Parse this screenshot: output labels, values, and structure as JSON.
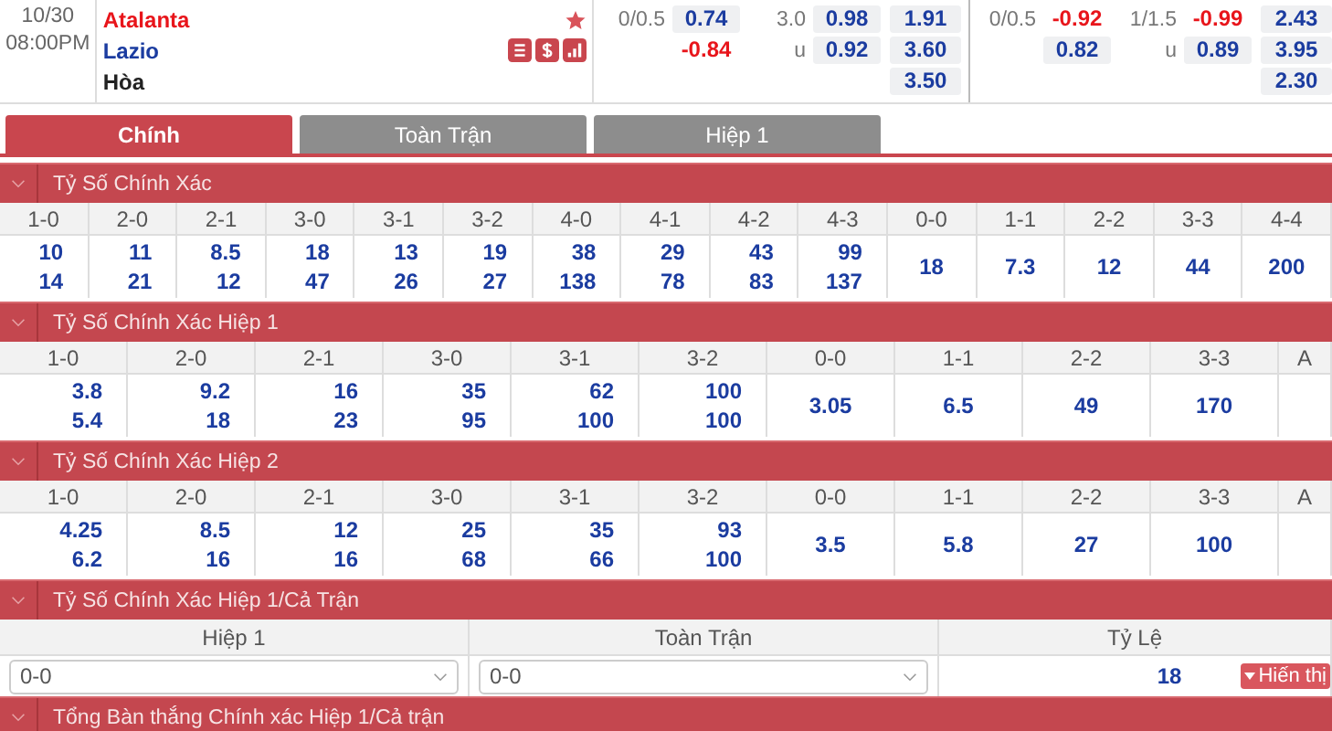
{
  "match": {
    "date": "10/30",
    "time": "08:00PM",
    "favorite": true,
    "teams": [
      {
        "name": "Atalanta",
        "kind": "home"
      },
      {
        "name": "Lazio",
        "kind": "away"
      },
      {
        "name": "Hòa",
        "kind": "draw"
      }
    ],
    "odds_groups": [
      {
        "handicap": [
          {
            "line": "0/0.5",
            "odds": "0.74",
            "kind": "normal"
          },
          {
            "odds": "-0.84",
            "kind": "negative"
          }
        ],
        "over_under": [
          {
            "line": "3.0",
            "odds": "0.98",
            "kind": "normal"
          },
          {
            "line": "u",
            "odds": "0.92",
            "kind": "normal"
          }
        ],
        "one_x_two": [
          "1.91",
          "3.60",
          "3.50"
        ]
      },
      {
        "handicap": [
          {
            "line": "0/0.5",
            "odds": "-0.92",
            "kind": "negative"
          },
          {
            "odds": "0.82",
            "kind": "normal"
          }
        ],
        "over_under": [
          {
            "line": "1/1.5",
            "odds": "-0.99",
            "kind": "negative"
          },
          {
            "line": "u",
            "odds": "0.89",
            "kind": "normal"
          }
        ],
        "one_x_two": [
          "2.43",
          "3.95",
          "2.30"
        ]
      }
    ]
  },
  "tabs": [
    {
      "label": "Chính",
      "selected": true
    },
    {
      "label": "Toàn Trận",
      "selected": false
    },
    {
      "label": "Hiệp 1",
      "selected": false
    }
  ],
  "sections": [
    {
      "title": "Tỷ Số Chính Xác",
      "kind": "grid",
      "columns": [
        {
          "label": "1-0",
          "values": [
            "10",
            "14"
          ]
        },
        {
          "label": "2-0",
          "values": [
            "11",
            "21"
          ]
        },
        {
          "label": "2-1",
          "values": [
            "8.5",
            "12"
          ]
        },
        {
          "label": "3-0",
          "values": [
            "18",
            "47"
          ]
        },
        {
          "label": "3-1",
          "values": [
            "13",
            "26"
          ]
        },
        {
          "label": "3-2",
          "values": [
            "19",
            "27"
          ]
        },
        {
          "label": "4-0",
          "values": [
            "38",
            "138"
          ]
        },
        {
          "label": "4-1",
          "values": [
            "29",
            "78"
          ]
        },
        {
          "label": "4-2",
          "values": [
            "43",
            "83"
          ]
        },
        {
          "label": "4-3",
          "values": [
            "99",
            "137"
          ]
        },
        {
          "label": "0-0",
          "values": [
            "18"
          ]
        },
        {
          "label": "1-1",
          "values": [
            "7.3"
          ]
        },
        {
          "label": "2-2",
          "values": [
            "12"
          ]
        },
        {
          "label": "3-3",
          "values": [
            "44"
          ]
        },
        {
          "label": "4-4",
          "values": [
            "200"
          ]
        }
      ]
    },
    {
      "title": "Tỷ Số Chính Xác Hiệp 1",
      "kind": "grid",
      "columns": [
        {
          "label": "1-0",
          "values": [
            "3.8",
            "5.4"
          ]
        },
        {
          "label": "2-0",
          "values": [
            "9.2",
            "18"
          ]
        },
        {
          "label": "2-1",
          "values": [
            "16",
            "23"
          ]
        },
        {
          "label": "3-0",
          "values": [
            "35",
            "95"
          ]
        },
        {
          "label": "3-1",
          "values": [
            "62",
            "100"
          ]
        },
        {
          "label": "3-2",
          "values": [
            "100",
            "100"
          ]
        },
        {
          "label": "0-0",
          "values": [
            "3.05"
          ]
        },
        {
          "label": "1-1",
          "values": [
            "6.5"
          ]
        },
        {
          "label": "2-2",
          "values": [
            "49"
          ]
        },
        {
          "label": "3-3",
          "values": [
            "170"
          ]
        },
        {
          "label": "A"
        }
      ]
    },
    {
      "title": "Tỷ Số Chính Xác Hiệp 2",
      "kind": "grid",
      "columns": [
        {
          "label": "1-0",
          "values": [
            "4.25",
            "6.2"
          ]
        },
        {
          "label": "2-0",
          "values": [
            "8.5",
            "16"
          ]
        },
        {
          "label": "2-1",
          "values": [
            "12",
            "16"
          ]
        },
        {
          "label": "3-0",
          "values": [
            "25",
            "68"
          ]
        },
        {
          "label": "3-1",
          "values": [
            "35",
            "66"
          ]
        },
        {
          "label": "3-2",
          "values": [
            "93",
            "100"
          ]
        },
        {
          "label": "0-0",
          "values": [
            "3.5"
          ]
        },
        {
          "label": "1-1",
          "values": [
            "5.8"
          ]
        },
        {
          "label": "2-2",
          "values": [
            "27"
          ]
        },
        {
          "label": "3-3",
          "values": [
            "100"
          ]
        },
        {
          "label": "A"
        }
      ]
    },
    {
      "title": "Tỷ Số Chính Xác Hiệp 1/Cả Trận",
      "kind": "pick",
      "headers": [
        "Hiệp 1",
        "Toàn Trận",
        "Tỷ Lệ"
      ],
      "first_half": "0-0",
      "full_time": "0-0",
      "rate": "18",
      "button": "Hiến thị"
    },
    {
      "title": "Tổng Bàn thắng Chính xác Hiệp 1/Cả trận",
      "kind": "collapsed"
    }
  ]
}
